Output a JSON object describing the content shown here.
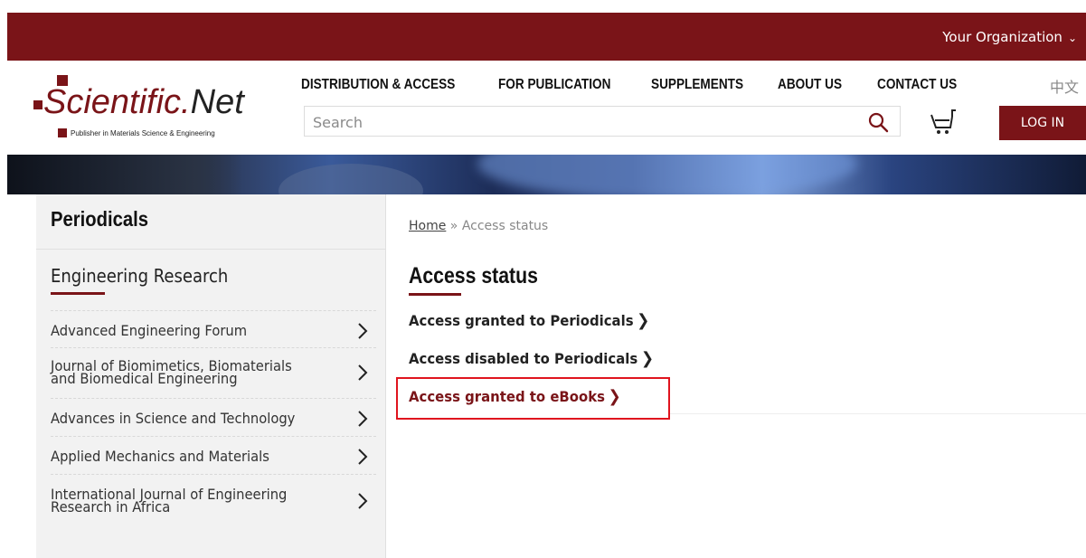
{
  "topbar": {
    "org_label": "Your Organization"
  },
  "logo": {
    "brand_main": "Scientific.",
    "brand_accent": "Net",
    "tagline": "Publisher in Materials Science & Engineering"
  },
  "nav": {
    "items": [
      "DISTRIBUTION & ACCESS",
      "FOR PUBLICATION",
      "SUPPLEMENTS",
      "ABOUT US",
      "CONTACT US"
    ],
    "language": "中文"
  },
  "search": {
    "placeholder": "Search"
  },
  "login_label": "LOG IN",
  "sidebar": {
    "title": "Periodicals",
    "subtitle": "Engineering Research",
    "items": [
      {
        "line1": "Advanced Engineering Forum",
        "line2": ""
      },
      {
        "line1": "Journal of Biomimetics, Biomaterials",
        "line2": "and Biomedical Engineering"
      },
      {
        "line1": "Advances in Science and Technology",
        "line2": ""
      },
      {
        "line1": "Applied Mechanics and Materials",
        "line2": ""
      },
      {
        "line1": "International Journal of Engineering",
        "line2": "Research in Africa"
      }
    ]
  },
  "breadcrumb": {
    "home": "Home",
    "separator": "»",
    "current": "Access status"
  },
  "main": {
    "title": "Access status",
    "links": [
      "Access granted to Periodicals",
      "Access disabled to Periodicals",
      "Access granted to eBooks"
    ]
  },
  "colors": {
    "brand": "#7a1418",
    "highlight": "#e0141e"
  },
  "icons": {
    "search": "search-icon",
    "cart": "cart-icon",
    "chevron": "chevron-right-icon"
  }
}
